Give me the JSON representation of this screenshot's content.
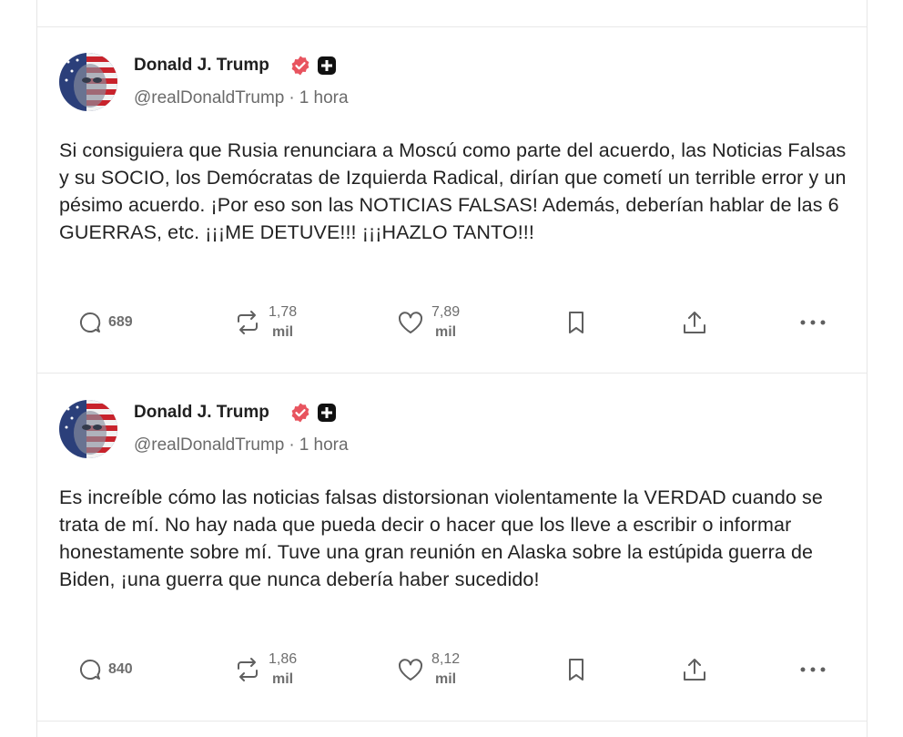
{
  "colors": {
    "verified": "#e8545f",
    "text": "#222222",
    "muted": "#6b6b6b",
    "border": "#e6e6e6"
  },
  "posts": [
    {
      "author": {
        "name": "Donald J. Trump",
        "handle": "@realDonaldTrump",
        "separator": "·",
        "time": "1 hora"
      },
      "text": "Si consiguiera que Rusia renunciara a Moscú como parte del acuerdo, las Noticias Falsas y su SOCIO, los Demócratas de Izquierda Radical, dirían que cometí un terrible error y un pésimo acuerdo. ¡Por eso son las NOTICIAS FALSAS! Además, deberían hablar de las 6 GUERRAS, etc. ¡¡¡ME DETUVE!!! ¡¡¡HAZLO TANTO!!!",
      "replies": "689",
      "reposts": {
        "value": "1,78",
        "unit": "mil"
      },
      "likes": {
        "value": "7,89",
        "unit": "mil"
      }
    },
    {
      "author": {
        "name": "Donald J. Trump",
        "handle": "@realDonaldTrump",
        "separator": "·",
        "time": "1 hora"
      },
      "text": "Es increíble cómo las noticias falsas distorsionan violentamente la VERDAD cuando se trata de mí. No hay nada que pueda decir o hacer que los lleve a escribir o informar honestamente sobre mí. Tuve una gran reunión en Alaska sobre la estúpida guerra de Biden, ¡una guerra que nunca debería haber sucedido!",
      "replies": "840",
      "reposts": {
        "value": "1,86",
        "unit": "mil"
      },
      "likes": {
        "value": "8,12",
        "unit": "mil"
      }
    }
  ],
  "icons": [
    "reply-icon",
    "repost-icon",
    "like-icon",
    "bookmark-icon",
    "share-icon",
    "more-icon",
    "verified-icon",
    "plus-badge-icon"
  ]
}
